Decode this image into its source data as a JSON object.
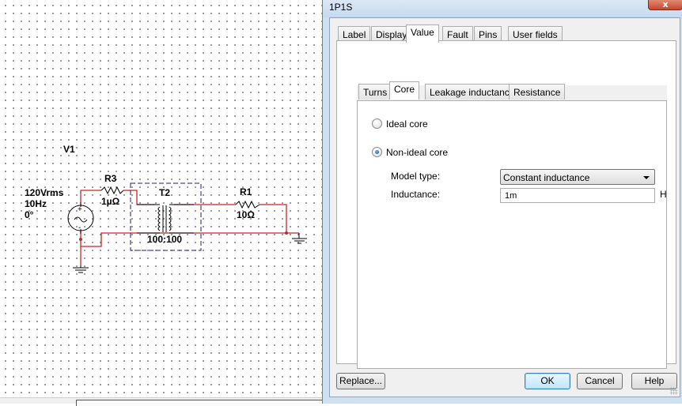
{
  "schematic": {
    "source": {
      "ref": "V1",
      "voltage": "120Vrms",
      "frequency": "10Hz",
      "phase": "0°",
      "plus": "+",
      "minus": "-"
    },
    "r3": {
      "ref": "R3",
      "value": "1µΩ"
    },
    "transformer": {
      "ref": "T2",
      "ratio": "100:100"
    },
    "r1": {
      "ref": "R1",
      "value": "10Ω"
    },
    "colors": {
      "wire": "#c0282b",
      "component": "#000000",
      "box": "#1f1f5a"
    }
  },
  "dialog": {
    "title": "1P1S",
    "close_label": "x",
    "tabs": [
      {
        "label": "Label",
        "active": false
      },
      {
        "label": "Display",
        "active": false
      },
      {
        "label": "Value",
        "active": true
      },
      {
        "label": "Fault",
        "active": false
      },
      {
        "label": "Pins",
        "active": false
      },
      {
        "label": "User fields",
        "active": false
      }
    ],
    "subtabs": [
      {
        "label": "Turns",
        "active": false
      },
      {
        "label": "Core",
        "active": true
      },
      {
        "label": "Leakage inductance",
        "active": false
      },
      {
        "label": "Resistance",
        "active": false
      }
    ],
    "core": {
      "ideal_label": "Ideal core",
      "ideal_checked": false,
      "nonideal_label": "Non-ideal core",
      "nonideal_checked": true,
      "model_type_label": "Model type:",
      "model_type_value": "Constant inductance",
      "inductance_label": "Inductance:",
      "inductance_value": "1m",
      "inductance_unit": "H"
    },
    "buttons": {
      "replace": "Replace...",
      "ok": "OK",
      "cancel": "Cancel",
      "help": "Help"
    }
  }
}
